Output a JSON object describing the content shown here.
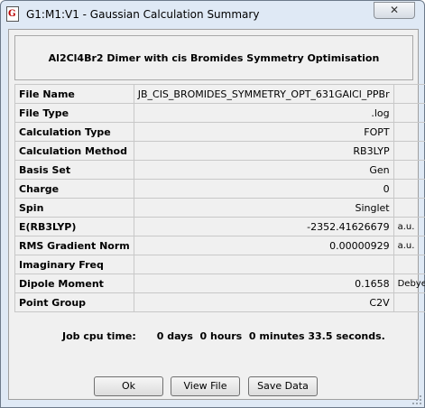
{
  "window": {
    "title": "G1:M1:V1 - Gaussian Calculation Summary",
    "app_icon_glyph": "G",
    "close_glyph": "✕"
  },
  "header": {
    "title": "Al2Cl4Br2 Dimer with cis Bromides Symmetry Optimisation"
  },
  "rows": [
    {
      "label": "File Name",
      "value": "JB_CIS_BROMIDES_SYMMETRY_OPT_631GAlCl_PPBr",
      "unit": ""
    },
    {
      "label": "File Type",
      "value": ".log",
      "unit": ""
    },
    {
      "label": "Calculation Type",
      "value": "FOPT",
      "unit": ""
    },
    {
      "label": "Calculation Method",
      "value": "RB3LYP",
      "unit": ""
    },
    {
      "label": "Basis Set",
      "value": "Gen",
      "unit": ""
    },
    {
      "label": "Charge",
      "value": "0",
      "unit": ""
    },
    {
      "label": "Spin",
      "value": "Singlet",
      "unit": ""
    },
    {
      "label": "E(RB3LYP)",
      "value": "-2352.41626679",
      "unit": "a.u."
    },
    {
      "label": "RMS Gradient Norm",
      "value": "0.00000929",
      "unit": "a.u."
    },
    {
      "label": "Imaginary Freq",
      "value": "",
      "unit": ""
    },
    {
      "label": "Dipole Moment",
      "value": "0.1658",
      "unit": "Debye"
    },
    {
      "label": "Point Group",
      "value": "C2V",
      "unit": ""
    }
  ],
  "cpu": {
    "text": "Job cpu time:      0 days  0 hours  0 minutes 33.5 seconds."
  },
  "buttons": {
    "ok": "Ok",
    "view_file": "View File",
    "save_data": "Save Data"
  }
}
